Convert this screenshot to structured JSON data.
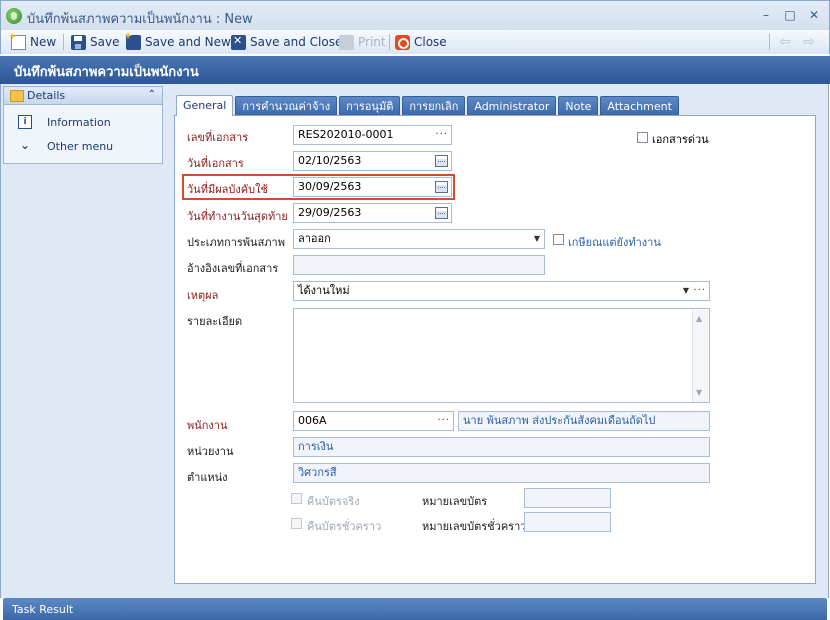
{
  "window": {
    "title": "บันทึกพ้นสภาพความเป็นพนักงาน : New",
    "minimize": "–",
    "maximize": "□",
    "close": "✕"
  },
  "toolbar": {
    "new_label": "New",
    "save_label": "Save",
    "save_new_label": "Save and New",
    "save_close_label": "Save and Close",
    "print_label": "Print",
    "close_label": "Close",
    "back_arrow": "⇦",
    "forward_arrow": "⇨"
  },
  "header": {
    "title": "บันทึกพ้นสภาพความเป็นพนักงาน"
  },
  "left_panel": {
    "title": "Details",
    "collapse": "⌃",
    "items": [
      {
        "label": "Information",
        "icon": "info-icon"
      },
      {
        "label": "Other menu",
        "icon": "double-chevron-down-icon"
      }
    ]
  },
  "tabs": [
    {
      "label": "General",
      "active": true
    },
    {
      "label": "การคำนวณค่าจ้าง",
      "active": false
    },
    {
      "label": "การอนุมัติ",
      "active": false
    },
    {
      "label": "การยกเลิก",
      "active": false
    },
    {
      "label": "Administrator",
      "active": false
    },
    {
      "label": "Note",
      "active": false
    },
    {
      "label": "Attachment",
      "active": false
    }
  ],
  "form": {
    "doc_no_label": "เลขที่เอกสาร",
    "doc_no_value": "RES202010-0001",
    "urgent_label": "เอกสารด่วน",
    "doc_date_label": "วันที่เอกสาร",
    "doc_date_value": "02/10/2563",
    "effective_date_label": "วันที่มีผลบังคับใช้",
    "effective_date_value": "30/09/2563",
    "last_work_date_label": "วันที่ทำงานวันสุดท้าย",
    "last_work_date_value": "29/09/2563",
    "resign_type_label": "ประเภทการพ้นสภาพ",
    "resign_type_value": "ลาออก",
    "retire_label": "เกษียณแต่ยังทำงาน",
    "ref_doc_label": "อ้างอิงเลขที่เอกสาร",
    "ref_doc_value": "",
    "reason_label": "เหตุผล",
    "reason_value": "ได้งานใหม่",
    "detail_label": "รายละเอียด",
    "detail_value": "",
    "employee_label": "พนักงาน",
    "employee_code": "006A",
    "employee_name": "นาย พ้นสภาพ ส่งประกันสังคมเดือนถัดไป",
    "department_label": "หน่วยงาน",
    "department_value": "การเงิน",
    "position_label": "ตำแหน่ง",
    "position_value": "วิศวกรสี",
    "return_card_label": "คืนบัตรจริง",
    "card_no_label": "หมายเลขบัตร",
    "card_no_value": "",
    "return_temp_card_label": "คืนบัตรชั่วคราว",
    "temp_card_no_label": "หมายเลขบัตรชั่วคราว",
    "temp_card_no_value": ""
  },
  "task_result": {
    "title": "Task Result"
  },
  "colors": {
    "header_blue": "#2c5697",
    "tab_blue": "#3b68a8",
    "required_label": "#8a1a1a",
    "highlight": "#d64a2e",
    "readonly_text": "#2c5fa8"
  }
}
